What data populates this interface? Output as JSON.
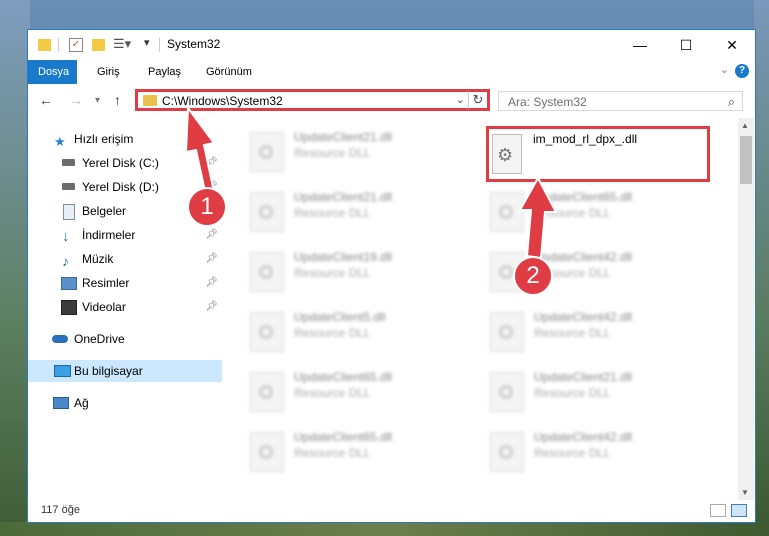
{
  "window": {
    "title": "System32"
  },
  "ribbon": {
    "tabs": [
      "Dosya",
      "Giriş",
      "Paylaş",
      "Görünüm"
    ],
    "help": "?"
  },
  "address": {
    "path": "C:\\Windows\\System32",
    "search_placeholder": "Ara: System32"
  },
  "nav": {
    "items": [
      {
        "label": "Hızlı erişim",
        "icon": "star-icon",
        "pinned": false
      },
      {
        "label": "Yerel Disk (C:)",
        "icon": "drive-icon",
        "pinned": true
      },
      {
        "label": "Yerel Disk (D:)",
        "icon": "drive-icon",
        "pinned": true
      },
      {
        "label": "Belgeler",
        "icon": "document-icon",
        "pinned": true
      },
      {
        "label": "İndirmeler",
        "icon": "download-icon",
        "pinned": true
      },
      {
        "label": "Müzik",
        "icon": "music-icon",
        "pinned": true
      },
      {
        "label": "Resimler",
        "icon": "pictures-icon",
        "pinned": true
      },
      {
        "label": "Videolar",
        "icon": "video-icon",
        "pinned": true
      },
      {
        "label": "OneDrive",
        "icon": "cloud-icon",
        "pinned": false
      },
      {
        "label": "Bu bilgisayar",
        "icon": "computer-icon",
        "pinned": false
      },
      {
        "label": "Ağ",
        "icon": "network-icon",
        "pinned": false
      }
    ]
  },
  "files": {
    "target": "im_mod_rl_dpx_.dll",
    "left_column": [
      {
        "name": "UpdateClient21.dll",
        "type": "Resource DLL"
      },
      {
        "name": "UpdateClient21.dll",
        "type": "Resource DLL"
      },
      {
        "name": "UpdateClient19.dll",
        "type": "Resource DLL"
      },
      {
        "name": "UpdateClient5.dll",
        "type": "Resource DLL"
      },
      {
        "name": "UpdateClient65.dll",
        "type": "Resource DLL"
      },
      {
        "name": "UpdateClient65.dll",
        "type": "Resource DLL"
      }
    ],
    "right_column": [
      {
        "name": "UpdateClient65.dll",
        "type": "Resource DLL"
      },
      {
        "name": "UpdateClient42.dll",
        "type": "Resource DLL"
      },
      {
        "name": "UpdateClient42.dll",
        "type": "Resource DLL"
      },
      {
        "name": "UpdateClient21.dll",
        "type": "Resource DLL"
      },
      {
        "name": "UpdateClient42.dll",
        "type": "Resource DLL"
      }
    ]
  },
  "status": {
    "count": "117 öğe"
  },
  "annotations": {
    "badge1": "1",
    "badge2": "2",
    "color": "#e03c43"
  }
}
